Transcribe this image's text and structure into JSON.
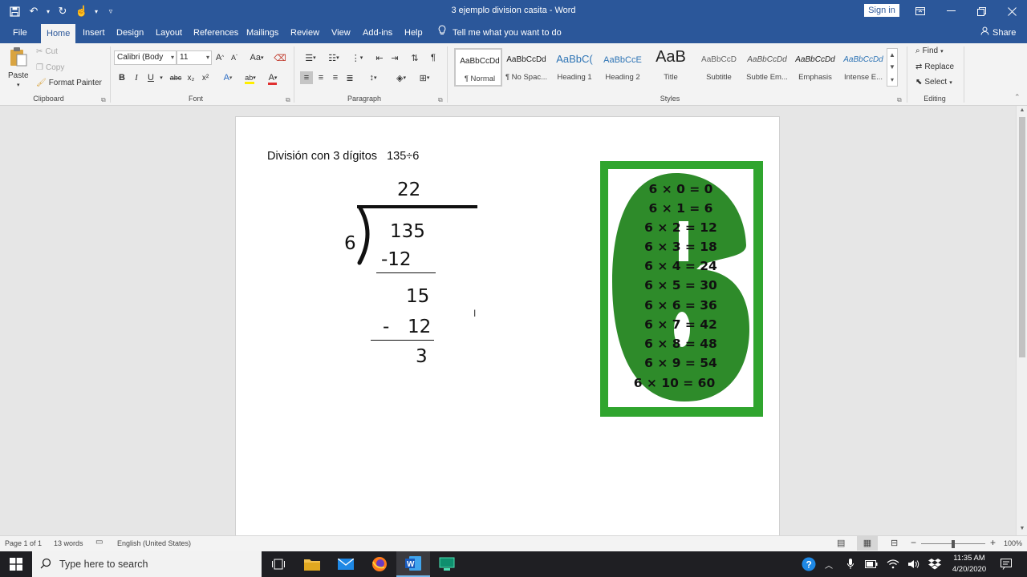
{
  "titlebar": {
    "document_title": "3 ejemplo division casita  -  Word",
    "sign_in": "Sign in",
    "qat_icons": [
      "save-icon",
      "undo-icon",
      "redo-icon",
      "touch-mode-icon",
      "customize-qat-icon"
    ]
  },
  "tabs": [
    "File",
    "Home",
    "Insert",
    "Design",
    "Layout",
    "References",
    "Mailings",
    "Review",
    "View",
    "Add-ins",
    "Help"
  ],
  "active_tab": "Home",
  "tell_me": "Tell me what you want to do",
  "share": "Share",
  "ribbon": {
    "clipboard": {
      "label": "Clipboard",
      "paste": "Paste",
      "cut": "Cut",
      "copy": "Copy",
      "format_painter": "Format Painter"
    },
    "font": {
      "label": "Font",
      "font_name": "Calibri (Body",
      "font_size": "11",
      "bold": "B",
      "italic": "I",
      "underline": "U",
      "strike": "abc",
      "subscript": "x₂",
      "superscript": "x²",
      "case": "Aa",
      "grow": "A",
      "shrink": "A",
      "font_color": "A",
      "text_effects": "A",
      "highlight": "ab",
      "underline_color": "#e03030",
      "highlight_color": "#ffee00"
    },
    "paragraph": {
      "label": "Paragraph"
    },
    "styles": {
      "label": "Styles",
      "items": [
        {
          "preview": "AaBbCcDd",
          "name": "¶ Normal"
        },
        {
          "preview": "AaBbCcDd",
          "name": "¶ No Spac..."
        },
        {
          "preview": "AaBbC(",
          "name": "Heading 1"
        },
        {
          "preview": "AaBbCcE",
          "name": "Heading 2"
        },
        {
          "preview": "AaB",
          "name": "Title"
        },
        {
          "preview": "AaBbCcD",
          "name": "Subtitle"
        },
        {
          "preview": "AaBbCcDd",
          "name": "Subtle Em..."
        },
        {
          "preview": "AaBbCcDd",
          "name": "Emphasis"
        },
        {
          "preview": "AaBbCcDd",
          "name": "Intense E..."
        }
      ]
    },
    "editing": {
      "label": "Editing",
      "find": "Find",
      "replace": "Replace",
      "select": "Select"
    }
  },
  "document": {
    "heading": "División con 3 dígitos   135÷6",
    "division": {
      "quotient": "22",
      "divisor": "6",
      "dividend": "135",
      "sub1": "-12",
      "remainder1": "15",
      "sub2_sign": "-",
      "sub2": "12",
      "remainder": "3"
    },
    "card": {
      "color": "#30a52e",
      "shape_color": "#2e8b2a",
      "big_digit": "6",
      "facts": [
        "6 × 0 = 0",
        "6 × 1 = 6",
        "6 × 2 = 12",
        "6 × 3 = 18",
        "6 × 4 = 24",
        "6 × 5 = 30",
        "6 × 6 = 36",
        "6 × 7 = 42",
        "6 × 8 = 48",
        "6 × 9 = 54",
        "6 × 10 = 60"
      ]
    }
  },
  "statusbar": {
    "page": "Page 1 of 1",
    "words": "13 words",
    "language": "English (United States)",
    "zoom": "100%"
  },
  "taskbar": {
    "search_placeholder": "Type here to search",
    "time": "11:35 AM",
    "date": "4/20/2020"
  }
}
